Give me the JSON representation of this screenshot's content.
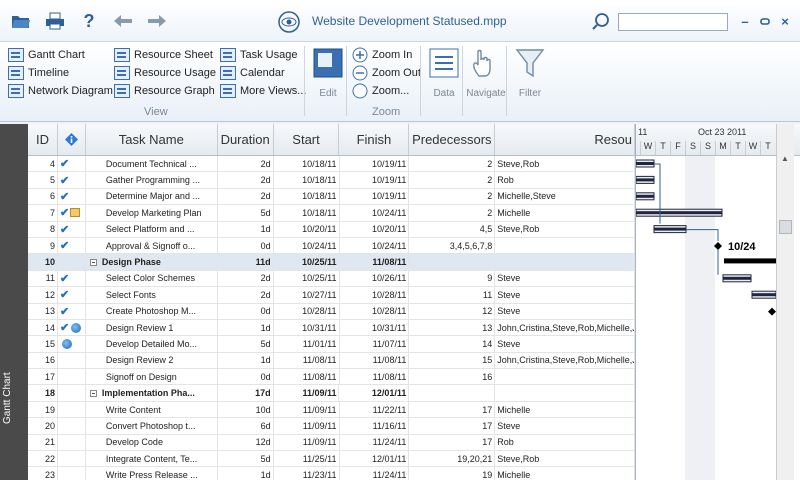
{
  "window": {
    "title": "Website Development Statused.mpp"
  },
  "search": {
    "placeholder": ""
  },
  "ribbon": {
    "view_items": [
      "Gantt Chart",
      "Timeline",
      "Network Diagram",
      "Resource Sheet",
      "Resource Usage",
      "Resource Graph",
      "Task Usage",
      "Calendar",
      "More Views..."
    ],
    "view_group": "View",
    "edit_label": "Edit",
    "zoom_items": [
      "Zoom In",
      "Zoom Out",
      "Zoom..."
    ],
    "zoom_group": "Zoom",
    "data_label": "Data",
    "navigate_label": "Navigate",
    "filter_label": "Filter"
  },
  "side_tab": {
    "label": "Gantt Chart"
  },
  "columns": [
    "ID",
    "Task Name",
    "Duration",
    "Start",
    "Finish",
    "Predecessors",
    "Resou"
  ],
  "rows": [
    {
      "id": "4",
      "ind": "check",
      "name": "Document Technical ...",
      "dur": "2d",
      "start": "10/18/11",
      "finish": "10/19/11",
      "pred": "2",
      "res": "Steve,Rob"
    },
    {
      "id": "5",
      "ind": "check",
      "name": "Gather Programming ...",
      "dur": "2d",
      "start": "10/18/11",
      "finish": "10/19/11",
      "pred": "2",
      "res": "Rob"
    },
    {
      "id": "6",
      "ind": "check",
      "name": "Determine Major and ...",
      "dur": "2d",
      "start": "10/18/11",
      "finish": "10/19/11",
      "pred": "2",
      "res": "Michelle,Steve"
    },
    {
      "id": "7",
      "ind": "check-note",
      "name": "Develop Marketing Plan",
      "dur": "5d",
      "start": "10/18/11",
      "finish": "10/24/11",
      "pred": "2",
      "res": "Michelle"
    },
    {
      "id": "8",
      "ind": "check",
      "name": "Select Platform and ...",
      "dur": "1d",
      "start": "10/20/11",
      "finish": "10/20/11",
      "pred": "4,5",
      "res": "Steve,Rob"
    },
    {
      "id": "9",
      "ind": "check",
      "name": "Approval & Signoff o...",
      "dur": "0d",
      "start": "10/24/11",
      "finish": "10/24/11",
      "pred": "3,4,5,6,7,8",
      "res": ""
    },
    {
      "id": "10",
      "ind": "",
      "name": "Design Phase",
      "dur": "11d",
      "start": "10/25/11",
      "finish": "11/08/11",
      "pred": "",
      "res": "",
      "summary": true
    },
    {
      "id": "11",
      "ind": "check",
      "name": "Select Color Schemes",
      "dur": "2d",
      "start": "10/25/11",
      "finish": "10/26/11",
      "pred": "9",
      "res": "Steve"
    },
    {
      "id": "12",
      "ind": "check",
      "name": "Select Fonts",
      "dur": "2d",
      "start": "10/27/11",
      "finish": "10/28/11",
      "pred": "11",
      "res": "Steve"
    },
    {
      "id": "13",
      "ind": "check",
      "name": "Create Photoshop M...",
      "dur": "0d",
      "start": "10/28/11",
      "finish": "10/28/11",
      "pred": "12",
      "res": "Steve"
    },
    {
      "id": "14",
      "ind": "check-globe",
      "name": "Design Review 1",
      "dur": "1d",
      "start": "10/31/11",
      "finish": "10/31/11",
      "pred": "13",
      "res": "John,Cristina,Steve,Rob,Michelle,Je"
    },
    {
      "id": "15",
      "ind": "globe",
      "name": "Develop Detailed Mo...",
      "dur": "5d",
      "start": "11/01/11",
      "finish": "11/07/11",
      "pred": "14",
      "res": "Steve"
    },
    {
      "id": "16",
      "ind": "",
      "name": "Design Review 2",
      "dur": "1d",
      "start": "11/08/11",
      "finish": "11/08/11",
      "pred": "15",
      "res": "John,Cristina,Steve,Rob,Michelle,Je"
    },
    {
      "id": "17",
      "ind": "",
      "name": "Signoff on Design",
      "dur": "0d",
      "start": "11/08/11",
      "finish": "11/08/11",
      "pred": "16",
      "res": ""
    },
    {
      "id": "18",
      "ind": "",
      "name": "Implementation Pha...",
      "dur": "17d",
      "start": "11/09/11",
      "finish": "12/01/11",
      "pred": "",
      "res": "",
      "summary": true
    },
    {
      "id": "19",
      "ind": "",
      "name": "Write Content",
      "dur": "10d",
      "start": "11/09/11",
      "finish": "11/22/11",
      "pred": "17",
      "res": "Michelle"
    },
    {
      "id": "20",
      "ind": "",
      "name": "Convert Photoshop t...",
      "dur": "6d",
      "start": "11/09/11",
      "finish": "11/16/11",
      "pred": "17",
      "res": "Steve"
    },
    {
      "id": "21",
      "ind": "",
      "name": "Develop Code",
      "dur": "12d",
      "start": "11/09/11",
      "finish": "11/24/11",
      "pred": "17",
      "res": "Rob"
    },
    {
      "id": "22",
      "ind": "",
      "name": "Integrate Content, Te...",
      "dur": "5d",
      "start": "11/25/11",
      "finish": "12/01/11",
      "pred": "19,20,21",
      "res": "Steve,Rob"
    },
    {
      "id": "23",
      "ind": "",
      "name": "Write Press Release ...",
      "dur": "1d",
      "start": "11/23/11",
      "finish": "11/24/11",
      "pred": "19",
      "res": "Michelle"
    }
  ],
  "gantt": {
    "week_label": "Oct 23 2011",
    "week_prev": "11",
    "days": [
      "W",
      "T",
      "F",
      "S",
      "S",
      "M",
      "T",
      "W",
      "T"
    ],
    "milestone_label": "10/24"
  },
  "colors": {
    "accent": "#2e5f96",
    "check": "#1f6fc7",
    "side_tab": "#4a4a4a"
  }
}
